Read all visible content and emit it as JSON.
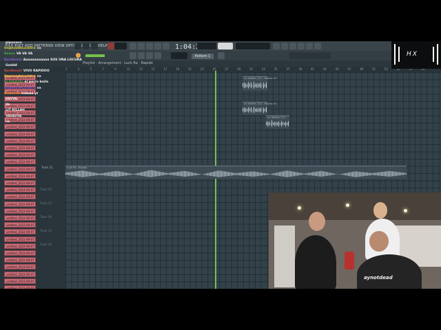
{
  "menubar": {
    "menus": "FILE EDIT ADD PATTERNS VIEW OPTIONS TOOLS HELP"
  },
  "toolbar": {
    "time": "1:04:27",
    "pattern_label": "Pattern 1"
  },
  "playlist": {
    "title": "Playlist · Arrangement · Luck Ra · Rapido"
  },
  "brand": {
    "logo": "HX"
  },
  "timeline_ticks": [
    "1",
    "3",
    "5",
    "7",
    "9",
    "11",
    "13",
    "15",
    "17",
    "19",
    "21",
    "23",
    "25",
    "27",
    "29",
    "31",
    "33",
    "35",
    "37",
    "39",
    "41",
    "43",
    "45",
    "47",
    "49",
    "51",
    "53",
    "55",
    "57",
    "59"
  ],
  "tracks": [
    "untitled_2022-09-07 19",
    "untitled_2022-09-07 19",
    "untitled_2022-09-07 19",
    "untitled_2022-09-07 19",
    "untitled_2022-09-07 19",
    "untitled_2022-09-07 19",
    "untitled_2022-09-07 19",
    "untitled_2022-09-07 19",
    "untitled_2022-09-07 19",
    "untitled_2022-09-07 19",
    "untitled_2022-09-07 19",
    "untitled_2022-09-07 19",
    "untitled_2022-09-07 19",
    "untitled_2022-09-07 19",
    "untitled_2022-09-07 19",
    "untitled_2022-09-07 19",
    "untitled_2022-09-07 19",
    "untitled_2022-09-07 19",
    "untitled_2022-09-07 19",
    "untitled_2022-09-07 19",
    "untitled_2022-09-07 19",
    "untitled_2022-09-07 19",
    "untitled_2022-09-07 19",
    "untitled_2022-09-07 19",
    "untitled_2022-09-07 19",
    "untitled_2022-09-07 19",
    "untitled_2022-09-07 19",
    "untitled_2022-09-07 19",
    "untitled_2022-09-07 19",
    "untitled_2022-09-07 19",
    "untitled_2022-09-07 19"
  ],
  "track_names": [
    "Track 11",
    "Track 12",
    "Track 13",
    "Track 14",
    "Track 15",
    "Track 16"
  ],
  "clips": [
    {
      "label": "un detalle_TLG - Rapido #1"
    },
    {
      "label": "un detalle_TLG - Rapido #2"
    },
    {
      "label": "un detalle_TLG"
    },
    {
      "label": "Luck Ra - Rapido"
    }
  ],
  "chat": [
    {
      "user": "",
      "msg": "piponoce"
    },
    {
      "user": "UnpeoodeLocktra",
      "msg": "va"
    },
    {
      "user": "Renzo",
      "msg": "VA VA VA"
    },
    {
      "user": "fjordmont",
      "msg": "Aaaaaaaaaaaa SOS UNA LOCURA"
    },
    {
      "user": "",
      "msg": "Goddd"
    },
    {
      "user": "fjordmont",
      "msg": "VIVO RAPIDOO"
    },
    {
      "user": "UnpeoodeLocktra",
      "msg": "va"
    },
    {
      "user": "bl_fatal1ty",
      "msg": "el perro baila"
    },
    {
      "user": "UnpeoodeLocktra",
      "msg": "va"
    },
    {
      "user": "bitdoneo",
      "msg": "holaaa yt"
    },
    {
      "user": "",
      "msg": "VAVVA"
    },
    {
      "user": "",
      "msg": "Va"
    },
    {
      "user": "",
      "msg": "LIT KILLAH"
    },
    {
      "user": "",
      "msg": "VAVAVVA"
    },
    {
      "user": "",
      "msg": "va"
    }
  ],
  "webcam": {
    "shirt_text": "aynotdead"
  },
  "colors": {
    "accent_green": "#7ac04a",
    "track_pink": "#c9707a",
    "grid": "#33424a"
  }
}
